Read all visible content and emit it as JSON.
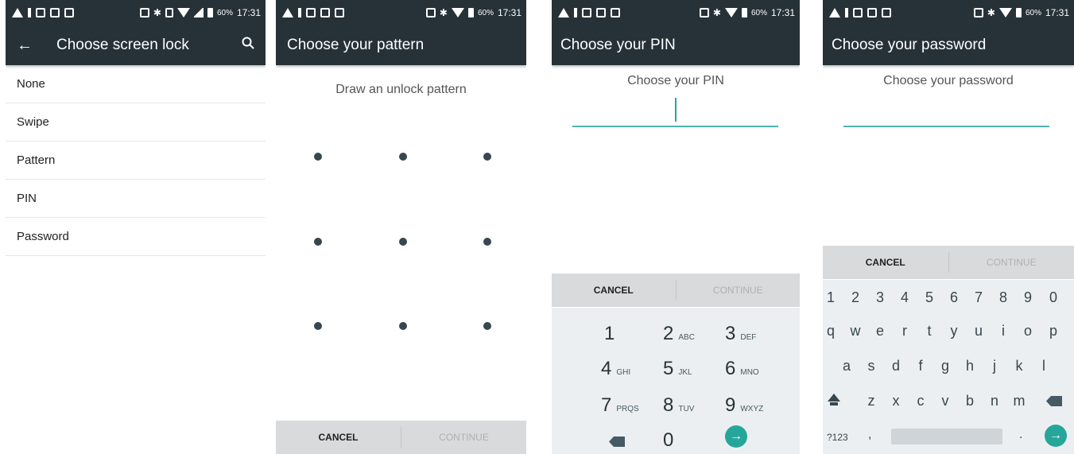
{
  "status": {
    "battery": "60%",
    "time": "17:31"
  },
  "screen1": {
    "title": "Choose screen lock",
    "options": [
      "None",
      "Swipe",
      "Pattern",
      "PIN",
      "Password"
    ]
  },
  "screen2": {
    "title": "Choose your pattern",
    "prompt": "Draw an unlock pattern",
    "cancel": "CANCEL",
    "continue": "CONTINUE"
  },
  "screen3": {
    "title": "Choose your PIN",
    "prompt": "Choose your PIN",
    "cancel": "CANCEL",
    "continue": "CONTINUE",
    "keys": [
      {
        "n": "1",
        "s": ""
      },
      {
        "n": "2",
        "s": "ABC"
      },
      {
        "n": "3",
        "s": "DEF"
      },
      {
        "n": "4",
        "s": "GHI"
      },
      {
        "n": "5",
        "s": "JKL"
      },
      {
        "n": "6",
        "s": "MNO"
      },
      {
        "n": "7",
        "s": "PRQS"
      },
      {
        "n": "8",
        "s": "TUV"
      },
      {
        "n": "9",
        "s": "WXYZ"
      },
      {
        "n": "0",
        "s": ""
      }
    ]
  },
  "screen4": {
    "title": "Choose your password",
    "prompt": "Choose your password",
    "cancel": "CANCEL",
    "continue": "CONTINUE",
    "row_numbers": [
      "1",
      "2",
      "3",
      "4",
      "5",
      "6",
      "7",
      "8",
      "9",
      "0"
    ],
    "row1": [
      "q",
      "w",
      "e",
      "r",
      "t",
      "y",
      "u",
      "i",
      "o",
      "p"
    ],
    "row2": [
      "a",
      "s",
      "d",
      "f",
      "g",
      "h",
      "j",
      "k",
      "l"
    ],
    "row3": [
      "z",
      "x",
      "c",
      "v",
      "b",
      "n",
      "m"
    ],
    "sym_key": "?123",
    "comma": ",",
    "period": "."
  },
  "colors": {
    "appbar": "#263238",
    "accent": "#4db6ac",
    "enter": "#26a69a"
  }
}
